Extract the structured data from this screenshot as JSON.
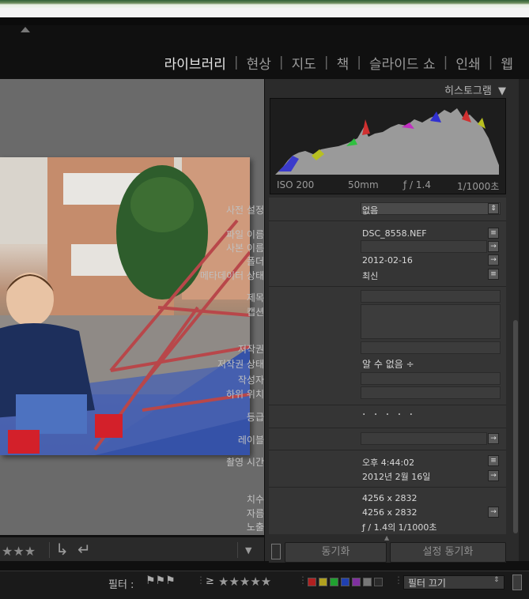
{
  "modules": [
    "라이브러리",
    "현상",
    "지도",
    "책",
    "슬라이드 쇼",
    "인쇄",
    "웹"
  ],
  "active_module": "라이브러리",
  "histogram": {
    "title": "히스토그램",
    "iso": "ISO 200",
    "focal": "50mm",
    "aperture": "ƒ / 1.4",
    "shutter": "1/1000초"
  },
  "metadata": {
    "preset_label": "사전 설정",
    "preset_value": "없음",
    "filename_label": "파일 이름",
    "filename_value": "DSC_8558.NEF",
    "copy_name_label": "사본 이름",
    "folder_label": "폴더",
    "folder_value": "2012-02-16",
    "status_label": "메타데이터 상태",
    "status_value": "최신",
    "title_label": "제목",
    "caption_label": "캡션",
    "copyright_label": "저작권",
    "copyright_status_label": "저작권 상태",
    "copyright_status_value": "알 수 없음 ÷",
    "creator_label": "작성자",
    "sublocation_label": "하위 위치",
    "rating_label": "등급",
    "rating_value": "· · · · ·",
    "label_label": "레이블",
    "capture_time_label": "촬영 시간",
    "capture_time_value": "오후 4:44:02",
    "capture_date_value": "2012년 2월 16일",
    "dimensions_label": "치수",
    "dimensions_value": "4256 x 2832",
    "cropped_label": "자름",
    "cropped_value": "4256 x 2832",
    "exposure_label": "노출",
    "exposure_value": "ƒ / 1.4의 1/1000초"
  },
  "toolbar": {
    "stars": "★★★",
    "sync_label": "동기화",
    "sync_settings_label": "설정 동기화"
  },
  "filter_bar": {
    "label": "필터 :",
    "rating_op": "≥",
    "rating_stars": "★★★★★",
    "filter_off": "필터 끄기"
  },
  "colors": {
    "panel_bg": "#353535",
    "center_bg": "#6a6a6a",
    "label_red": "#b02020",
    "label_yellow": "#b0a020",
    "label_green": "#20a030",
    "label_blue": "#2040b0",
    "label_purple": "#8030a0"
  }
}
